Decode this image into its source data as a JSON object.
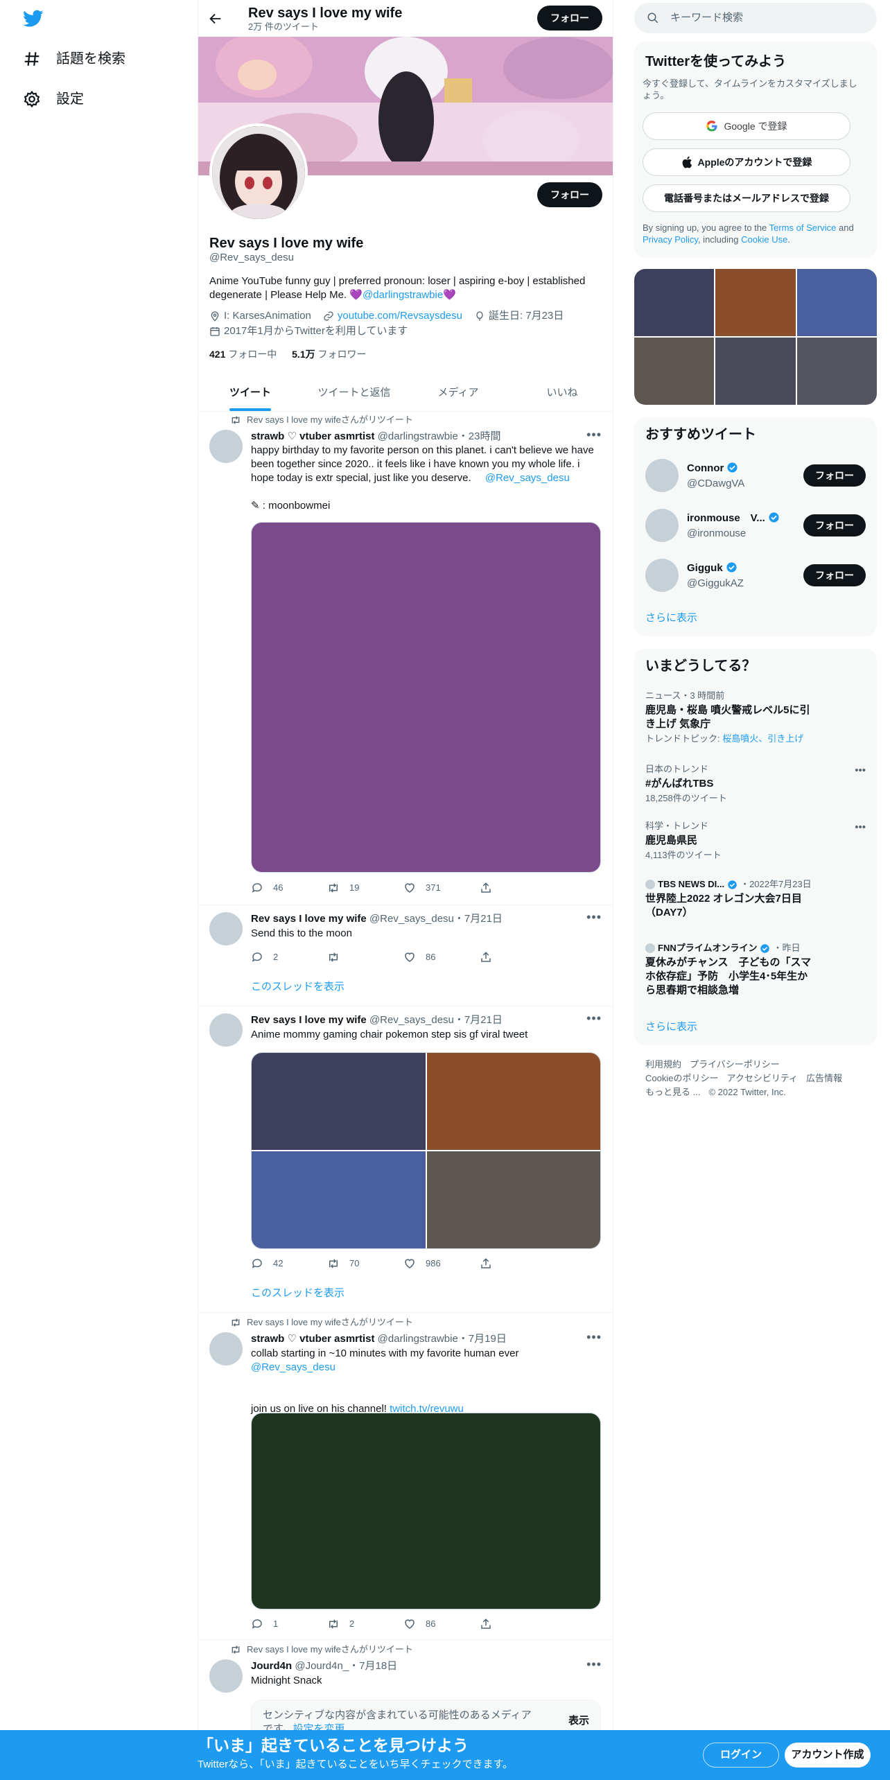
{
  "nav": {
    "explore_label": "話題を検索",
    "settings_label": "設定"
  },
  "topbar": {
    "name": "Rev says I love my wife",
    "tweet_count": "2万 件のツイート",
    "follow_label": "フォロー"
  },
  "profile": {
    "name": "Rev says I love my wife",
    "handle": "@Rev_says_desu",
    "follow_label": "フォロー",
    "bio_text": "Anime YouTube funny guy | preferred pronoun: loser | aspiring e-boy | established degenerate | Please Help Me. ",
    "bio_heart1": "💜",
    "bio_mention": "@darlingstrawbie",
    "bio_heart2": "💜",
    "location": "I: KarsesAnimation",
    "website": "youtube.com/Revsaysdesu",
    "birthday": "誕生日: 7月23日",
    "joined": "2017年1月からTwitterを利用しています",
    "following_count": "421",
    "following_label": "フォロー中",
    "followers_count": "5.1万",
    "followers_label": "フォロワー"
  },
  "tabs": [
    "ツイート",
    "ツイートと返信",
    "メディア",
    "いいね"
  ],
  "tweets": [
    {
      "retweet_label": "Rev says I love my wifeさんがリツイート",
      "name": "strawb ♡ vtuber asmrtist",
      "handle": "@darlingstrawbie",
      "time": "・23時間",
      "text": "happy birthday to my favorite person on this planet. i can't believe we have been together since 2020.. it feels like i have known you my whole life. i hope today is extr special, just like you deserve.",
      "mention": "@Rev_says_desu",
      "credit": "✎ : moonbowmei",
      "media_color": "#7b4a8c",
      "replies": "46",
      "retweets": "19",
      "likes": "371"
    },
    {
      "name": "Rev says I love my wife",
      "handle": "@Rev_says_desu",
      "time": "・7月21日",
      "text": "Send this to the moon",
      "replies": "2",
      "retweets": "",
      "likes": "86",
      "thread_label": "このスレッドを表示"
    },
    {
      "name": "Rev says I love my wife",
      "handle": "@Rev_says_desu",
      "time": "・7月21日",
      "text": "Anime mommy gaming chair pokemon step sis gf viral tweet",
      "media_colors": [
        "#3d3f5c",
        "#8b4e2b",
        "#4a5f9e",
        "#5c5650"
      ],
      "replies": "42",
      "retweets": "70",
      "likes": "986",
      "thread_label": "このスレッドを表示"
    },
    {
      "retweet_label": "Rev says I love my wifeさんがリツイート",
      "name": "strawb ♡ vtuber asmrtist",
      "handle": "@darlingstrawbie",
      "time": "・7月19日",
      "text": "collab starting in ~10 minutes with my favorite human ever",
      "mention": "@Rev_says_desu",
      "text2": "join us on live on his channel!",
      "link": "twitch.tv/revuwu",
      "media_color": "#1f3520",
      "replies": "1",
      "retweets": "2",
      "likes": "86"
    },
    {
      "retweet_label": "Rev says I love my wifeさんがリツイート",
      "name": "Jourd4n",
      "handle": "@Jourd4n_",
      "time": "・7月18日",
      "text": "Midnight Snack",
      "sensitive_text": "センシティブな内容が含まれている可能性のあるメディアです。",
      "sensitive_link": "設定を変更",
      "show_label": "表示"
    }
  ],
  "right": {
    "search_placeholder": "キーワード検索",
    "signup": {
      "title": "Twitterを使ってみよう",
      "sub": "今すぐ登録して、タイムラインをカスタマイズしましょう。",
      "google": "Google で登録",
      "apple": "Appleのアカウントで登録",
      "phone": "電話番号またはメールアドレスで登録",
      "terms_pre": "By signing up, you agree to the ",
      "terms": "Terms of Service",
      "and": " and ",
      "privacy": "Privacy Policy",
      "including": ", including ",
      "cookie": "Cookie Use",
      "dot": "."
    },
    "media_colors": [
      "#3d3f5c",
      "#8b4e2b",
      "#4a5f9e",
      "#5c5650",
      "#4a4a58",
      "#55555f"
    ],
    "recommend": {
      "title": "おすすめツイート",
      "users": [
        {
          "name": "Connor",
          "handle": "@CDawgVA",
          "follow": "フォロー"
        },
        {
          "name": "ironmouse　V...",
          "handle": "@ironmouse",
          "follow": "フォロー"
        },
        {
          "name": "Gigguk",
          "handle": "@GiggukAZ",
          "follow": "フォロー"
        }
      ],
      "more": "さらに表示"
    },
    "trends": {
      "title": "いまどうしてる？",
      "items": [
        {
          "context": "ニュース・3 時間前",
          "title": "鹿児島・桜島 噴火警戒レベル5に引き上げ 気象庁",
          "topic_label": "トレンドトピック: ",
          "topics": "桜島噴火、引き上げ"
        },
        {
          "context": "日本のトレンド",
          "title": "#がんばれTBS",
          "count": "18,258件のツイート"
        },
        {
          "context": "科学・トレンド",
          "title": "鹿児島県民",
          "count": "4,113件のツイート"
        },
        {
          "source": "TBS NEWS DI...",
          "time": "・2022年7月23日",
          "title": "世界陸上2022 オレゴン大会7日目（DAY7）"
        },
        {
          "source": "FNNプライムオンライン",
          "time": "・昨日",
          "title": "夏休みがチャンス　子どもの「スマホ依存症」予防　小学生4･5年生から思春期で相談急増"
        }
      ],
      "more": "さらに表示"
    },
    "footer": [
      "利用規約",
      "プライバシーポリシー",
      "Cookieのポリシー",
      "アクセシビリティ",
      "広告情報",
      "もっと見る ...",
      "© 2022 Twitter, Inc."
    ]
  },
  "bottom": {
    "title": "「いま」起きていることを見つけよう",
    "sub": "Twitterなら、「いま」起きていることをいち早くチェックできます。",
    "login": "ログイン",
    "signup": "アカウント作成"
  },
  "colors": {
    "accent": "#1d9bf0",
    "dark": "#0f1419",
    "muted": "#536471"
  }
}
